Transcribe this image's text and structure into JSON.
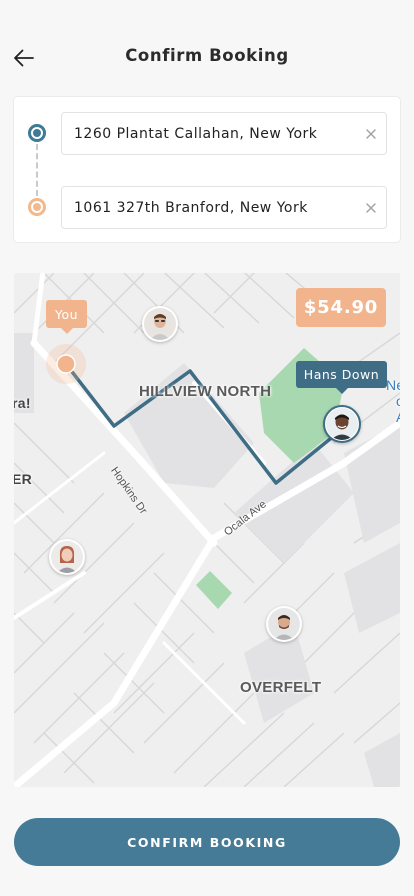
{
  "header": {
    "title": "Confirm Booking",
    "back_icon": "arrow-left-icon"
  },
  "route": {
    "pickup": {
      "value": "1260 Plantat Callahan, New York",
      "clear_icon": "close-icon"
    },
    "dropoff": {
      "value": "1061 327th Branford, New York",
      "clear_icon": "close-icon"
    }
  },
  "map": {
    "areas": [
      "HILLVIEW NORTH",
      "OVERFELT"
    ],
    "streets": [
      "Hopkins Dr",
      "Ocala Ave"
    ],
    "edge_text": [
      "ra!",
      "ER",
      "Neig",
      "o",
      "A"
    ],
    "price": "$54.90",
    "you_label": "You",
    "driver_label": "Hans Down"
  },
  "actions": {
    "confirm_label": "CONFIRM BOOKING"
  },
  "colors": {
    "accent": "#457b96",
    "route_line": "#3f6d86",
    "highlight": "#f2b48c",
    "park": "#a8d8b0"
  }
}
